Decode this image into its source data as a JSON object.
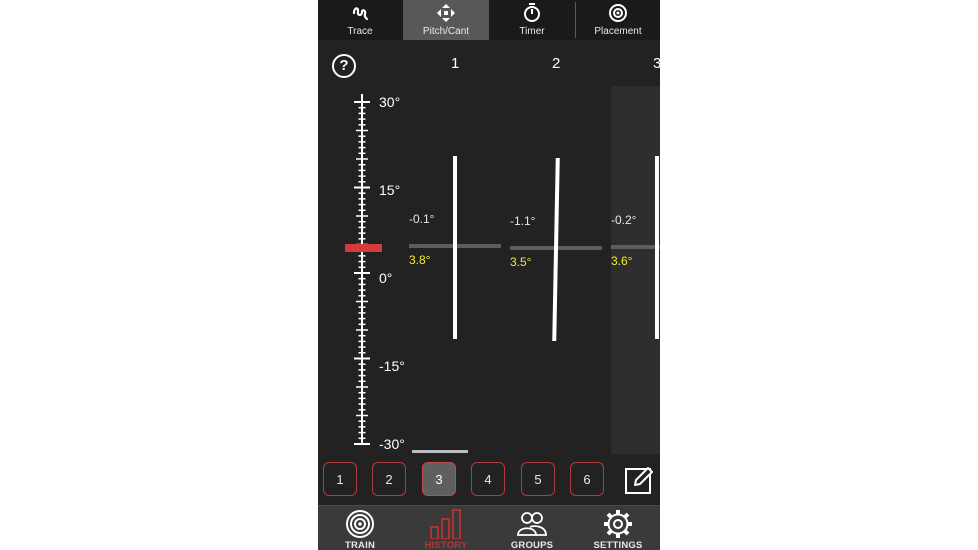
{
  "modes": [
    {
      "label": "Trace",
      "icon": "trace-icon"
    },
    {
      "label": "Pitch/Cant",
      "icon": "move-arrows-icon",
      "active": true
    },
    {
      "label": "Timer",
      "icon": "stopwatch-icon"
    },
    {
      "label": "Placement",
      "icon": "target-icon"
    }
  ],
  "columns": {
    "headers": [
      "1",
      "2",
      "3"
    ]
  },
  "scale": {
    "labels": [
      "30°",
      "15°",
      "0°",
      "-15°",
      "-30°"
    ]
  },
  "shots": [
    {
      "cant": "-0.1°",
      "pitch": "3.8°"
    },
    {
      "cant": "-1.1°",
      "pitch": "3.5°"
    },
    {
      "cant": "-0.2°",
      "pitch": "3.6°"
    }
  ],
  "shot_buttons": [
    "1",
    "2",
    "3",
    "4",
    "5",
    "6"
  ],
  "selected_shot": "3",
  "nav": [
    {
      "label": "TRAIN",
      "icon": "target-rings-icon"
    },
    {
      "label": "HISTORY",
      "icon": "bar-chart-icon",
      "active": true
    },
    {
      "label": "GROUPS",
      "icon": "users-icon"
    },
    {
      "label": "SETTINGS",
      "icon": "gear-icon"
    }
  ],
  "colors": {
    "accent": "#b8342f",
    "pitch": "#f1ee2a",
    "background": "#232223"
  }
}
